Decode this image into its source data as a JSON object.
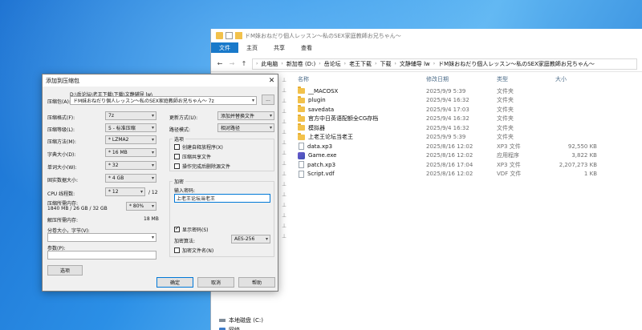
{
  "explorer": {
    "title": "ドM妹おねだり個人レッスン～私のSEX家庭教師お兄ちゃん～",
    "ribbon_tabs": [
      "文件",
      "主页",
      "共享",
      "查看"
    ],
    "nav": {
      "back": "←",
      "forward": "→",
      "up": "↑"
    },
    "breadcrumb": [
      "此电脑",
      "新加卷 (D:)",
      "岳论坛",
      "老王下载",
      "下载",
      "文静辅导 lw",
      "ドM妹おねだり個人レッスン～私のSEX家庭教師お兄ちゃん～"
    ],
    "columns": {
      "name": "名称",
      "date": "修改日期",
      "type": "类型",
      "size": "大小"
    },
    "rows": [
      {
        "name": "__MACOSX",
        "date": "2025/9/9 5:39",
        "type": "文件夹",
        "size": "",
        "icon": "folder-icon"
      },
      {
        "name": "plugin",
        "date": "2025/9/4 16:32",
        "type": "文件夹",
        "size": "",
        "icon": "folder-icon"
      },
      {
        "name": "savedata",
        "date": "2025/9/4 17:03",
        "type": "文件夹",
        "size": "",
        "icon": "folder-icon"
      },
      {
        "name": "官方中日英语配额全CG存档",
        "date": "2025/9/4 16:32",
        "type": "文件夹",
        "size": "",
        "icon": "folder-icon"
      },
      {
        "name": "模拟器",
        "date": "2025/9/4 16:32",
        "type": "文件夹",
        "size": "",
        "icon": "folder-icon"
      },
      {
        "name": "上老王论坛当老王",
        "date": "2025/9/9 5:39",
        "type": "文件夹",
        "size": "",
        "icon": "folder-icon"
      },
      {
        "name": "data.xp3",
        "date": "2025/8/16 12:02",
        "type": "XP3 文件",
        "size": "92,550 KB",
        "icon": "file-icon"
      },
      {
        "name": "Game.exe",
        "date": "2025/8/16 12:02",
        "type": "应用程序",
        "size": "3,822 KB",
        "icon": "exe-icon"
      },
      {
        "name": "patch.xp3",
        "date": "2025/8/16 17:04",
        "type": "XP3 文件",
        "size": "2,207,273 KB",
        "icon": "file-icon"
      },
      {
        "name": "Script.vdf",
        "date": "2025/8/16 12:02",
        "type": "VDF 文件",
        "size": "1 KB",
        "icon": "file-icon"
      }
    ],
    "nav_bottom": [
      {
        "label": "本地磁盘 (C:)"
      },
      {
        "label": "网络"
      }
    ]
  },
  "dialog": {
    "title": "添加到压缩包",
    "close": "✕",
    "archive_label": "压缩包(A):",
    "archive_path_top": "D:\\岳论坛\\老王下载\\下载\\文静辅导 lw\\",
    "archive_value": "ドM妹おねだり個人レッスン～私のSEX家庭教師お兄ちゃん～ 7z",
    "browse": "...",
    "fields": [
      {
        "label": "压缩格式(F):",
        "value": "7z"
      },
      {
        "label": "压缩等级(L):",
        "value": "5 - 标准压缩"
      },
      {
        "label": "压缩方法(M):",
        "value": "* LZMA2"
      },
      {
        "label": "字典大小(D):",
        "value": "* 16 MB"
      },
      {
        "label": "单词大小(W):",
        "value": "* 32"
      },
      {
        "label": "固实数据大小:",
        "value": "* 4 GB"
      },
      {
        "label": "CPU 线程数:",
        "value": "* 12",
        "suffix": "/ 12"
      }
    ],
    "memory": {
      "label": "压缩所需内存:",
      "detail": "1840 MB / 26 GB / 32 GB",
      "value": "* 80%"
    },
    "decompress_mem": {
      "label": "解压所需内存:",
      "value": "18 MB"
    },
    "split": {
      "label": "分卷大小，字节(V):"
    },
    "params": {
      "label": "参数(P):"
    },
    "options_btn": "选项",
    "update_mode": {
      "label": "更新方式(U):",
      "value": "添加并替换文件"
    },
    "path_mode": {
      "label": "路径模式:",
      "value": "相对路径"
    },
    "options_group": {
      "title": "选项",
      "items": [
        {
          "label": "创建自释放程序(X)",
          "checked": false
        },
        {
          "label": "压缩共享文件",
          "checked": false
        },
        {
          "label": "操作完成后删除源文件",
          "checked": false
        }
      ]
    },
    "encrypt_group": {
      "title": "加密",
      "password_label": "输入密码:",
      "password_value": "上老王论坛当老王",
      "show_password": {
        "label": "显示密码(S)",
        "checked": true
      },
      "method_label": "加密算法:",
      "method_value": "AES-256",
      "encrypt_names": {
        "label": "加密文件名(N)",
        "checked": false
      }
    },
    "buttons": {
      "ok": "确定",
      "cancel": "取消",
      "help": "帮助"
    }
  }
}
